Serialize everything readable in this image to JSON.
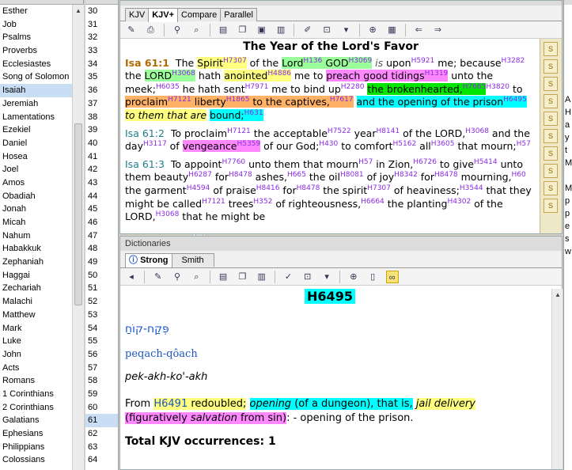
{
  "books": [
    "Esther",
    "Job",
    "Psalms",
    "Proverbs",
    "Ecclesiastes",
    "Song of Solomon",
    "Isaiah",
    "Jeremiah",
    "Lamentations",
    "Ezekiel",
    "Daniel",
    "Hosea",
    "Joel",
    "Amos",
    "Obadiah",
    "Jonah",
    "Micah",
    "Nahum",
    "Habakkuk",
    "Zephaniah",
    "Haggai",
    "Zechariah",
    "Malachi",
    "Matthew",
    "Mark",
    "Luke",
    "John",
    "Acts",
    "Romans",
    "1 Corinthians",
    "2 Corinthians",
    "Galatians",
    "Ephesians",
    "Philippians",
    "Colossians"
  ],
  "selected_book": "Isaiah",
  "chapters": [
    "30",
    "31",
    "32",
    "33",
    "34",
    "35",
    "36",
    "37",
    "38",
    "39",
    "40",
    "41",
    "42",
    "43",
    "44",
    "45",
    "46",
    "47",
    "48",
    "49",
    "50",
    "51",
    "52",
    "53",
    "54",
    "55",
    "56",
    "57",
    "58",
    "59",
    "60",
    "61",
    "62",
    "63",
    "64"
  ],
  "selected_chapter": "61",
  "bible_tabs": [
    "KJV",
    "KJV+",
    "Compare",
    "Parallel"
  ],
  "active_bible_tab": "KJV+",
  "passage_title": "The Year of the Lord's Favor",
  "dict_title": "Dictionaries",
  "dict_tabs": [
    "Strong",
    "Smith"
  ],
  "entry": {
    "number": "H6495",
    "hebrew": "פְּקַח-קוֹחַ",
    "translit": "peqach-qôach",
    "pronounce": "pek-akh-ko'-akh",
    "def_from": "From",
    "def_ref": "H6491",
    "def_1": "redoubled",
    "def_2": "opening",
    "def_3": "(of a dungeon), that is,",
    "def_4": "jail",
    "def_5": "delivery",
    "def_6": "(figuratively",
    "def_7": "salvation",
    "def_8": "from sin)",
    "def_9": ": - opening of the prison.",
    "total": "Total KJV occurrences: 1"
  },
  "right_chars": [
    "A",
    "H",
    "a",
    "y",
    "t",
    "M",
    "",
    "M",
    "p",
    "p",
    "e",
    "s",
    "w"
  ],
  "colors": {
    "cyan": "#00ffff",
    "yellow": "#ffff80",
    "pink": "#ff88ff",
    "green": "#00e600",
    "orange": "#ffb266",
    "strong_sup": "#8a2be2",
    "verse_ref": "#1e7d8c"
  }
}
